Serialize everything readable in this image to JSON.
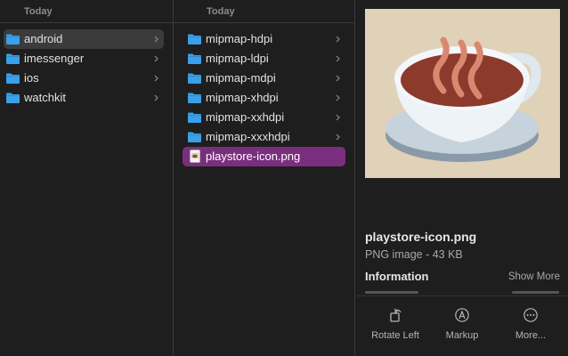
{
  "columns": [
    {
      "header": "Today",
      "items": [
        {
          "label": "android",
          "kind": "folder",
          "state": "active"
        },
        {
          "label": "imessenger",
          "kind": "folder",
          "state": ""
        },
        {
          "label": "ios",
          "kind": "folder",
          "state": ""
        },
        {
          "label": "watchkit",
          "kind": "folder",
          "state": ""
        }
      ]
    },
    {
      "header": "Today",
      "items": [
        {
          "label": "mipmap-hdpi",
          "kind": "folder",
          "state": ""
        },
        {
          "label": "mipmap-ldpi",
          "kind": "folder",
          "state": ""
        },
        {
          "label": "mipmap-mdpi",
          "kind": "folder",
          "state": ""
        },
        {
          "label": "mipmap-xhdpi",
          "kind": "folder",
          "state": ""
        },
        {
          "label": "mipmap-xxhdpi",
          "kind": "folder",
          "state": ""
        },
        {
          "label": "mipmap-xxxhdpi",
          "kind": "folder",
          "state": ""
        },
        {
          "label": "playstore-icon.png",
          "kind": "file",
          "state": "selected"
        }
      ]
    }
  ],
  "preview": {
    "file_name": "playstore-icon.png",
    "file_meta": "PNG image - 43 KB",
    "info_title": "Information",
    "show_more": "Show More",
    "image_icon": "coffee-cup-icon"
  },
  "actions": [
    {
      "label": "Rotate Left",
      "icon": "rotate-left-icon"
    },
    {
      "label": "Markup",
      "icon": "markup-icon"
    },
    {
      "label": "More...",
      "icon": "more-icon"
    }
  ],
  "colors": {
    "folder": "#3aa0e8",
    "selection": "#7a2f7e",
    "active_row": "#3b3b3b",
    "thumb_bg": "#e0d1b9"
  }
}
